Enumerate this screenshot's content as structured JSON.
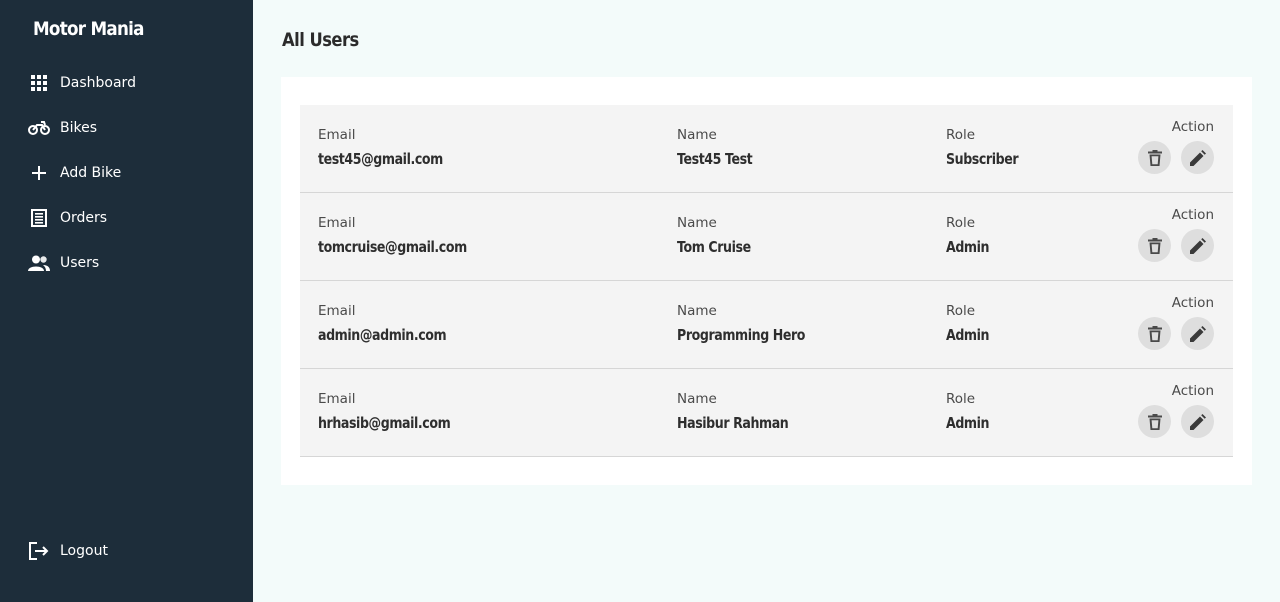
{
  "app": {
    "brand": "Motor Mania"
  },
  "sidebar": {
    "items": [
      {
        "label": "Dashboard",
        "icon": "dashboard-grid-icon"
      },
      {
        "label": "Bikes",
        "icon": "motorcycle-icon"
      },
      {
        "label": "Add Bike",
        "icon": "plus-icon"
      },
      {
        "label": "Orders",
        "icon": "receipt-icon"
      },
      {
        "label": "Users",
        "icon": "users-icon"
      }
    ],
    "logout": {
      "label": "Logout",
      "icon": "logout-icon"
    }
  },
  "main": {
    "title": "All Users",
    "headers": {
      "email": "Email",
      "name": "Name",
      "role": "Role",
      "action": "Action"
    },
    "users": [
      {
        "email": "test45@gmail.com",
        "name": "Test45 Test",
        "role": "Subscriber"
      },
      {
        "email": "tomcruise@gmail.com",
        "name": "Tom Cruise",
        "role": "Admin"
      },
      {
        "email": "admin@admin.com",
        "name": "Programming Hero",
        "role": "Admin"
      },
      {
        "email": "hrhasib@gmail.com",
        "name": "Hasibur Rahman",
        "role": "Admin"
      }
    ]
  },
  "colors": {
    "sidebar_bg": "#1d2d3a",
    "page_bg": "#f3fbfa",
    "row_bg": "#f4f4f4",
    "icon_button_bg": "#dedede"
  }
}
